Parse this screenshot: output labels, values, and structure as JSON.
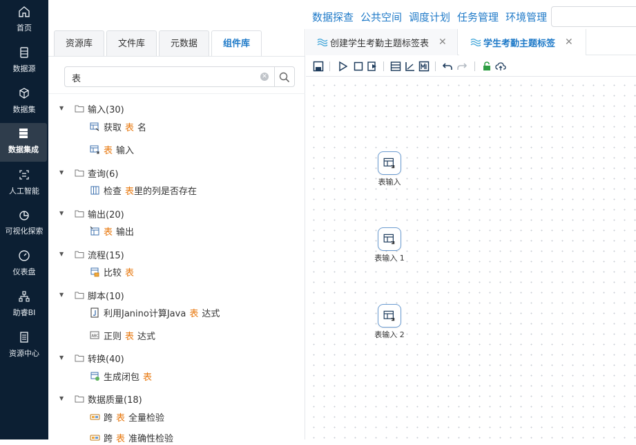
{
  "sidebar": {
    "items": [
      {
        "label": "首页",
        "icon": "home-icon"
      },
      {
        "label": "数据源",
        "icon": "database-icon"
      },
      {
        "label": "数据集",
        "icon": "cube-icon"
      },
      {
        "label": "数据集成",
        "icon": "server-stack-icon",
        "active": true
      },
      {
        "label": "人工智能",
        "icon": "ai-scan-icon"
      },
      {
        "label": "可视化探索",
        "icon": "pie-chart-icon"
      },
      {
        "label": "仪表盘",
        "icon": "gauge-icon"
      },
      {
        "label": "助睿BI",
        "icon": "org-chart-icon"
      },
      {
        "label": "资源中心",
        "icon": "document-icon"
      }
    ]
  },
  "topnav": {
    "links": [
      "数据探查",
      "公共空间",
      "调度计划",
      "任务管理",
      "环境管理"
    ]
  },
  "library": {
    "tabs": [
      "资源库",
      "文件库",
      "元数据",
      "组件库"
    ],
    "active_tab": "组件库",
    "search": {
      "value": "表"
    },
    "tree": [
      {
        "label": "输入(30)",
        "items": [
          {
            "before": "获取",
            "hl": "表",
            "after": "名",
            "icon": "get-table-name-icon"
          },
          {
            "before": "",
            "hl": "表",
            "after": "输入",
            "icon": "table-input-icon"
          }
        ]
      },
      {
        "label": "查询(6)",
        "items": [
          {
            "before": "检查",
            "hl": "表",
            "after": "里的列是否存在",
            "icon": "check-columns-icon"
          }
        ]
      },
      {
        "label": "输出(20)",
        "items": [
          {
            "before": "",
            "hl": "表",
            "after": "输出",
            "icon": "table-output-icon"
          }
        ]
      },
      {
        "label": "流程(15)",
        "items": [
          {
            "before": "比较",
            "hl": "表",
            "after": "",
            "icon": "compare-table-icon"
          }
        ]
      },
      {
        "label": "脚本(10)",
        "items": [
          {
            "before": "利用Janino计算Java",
            "hl": "表",
            "after": "达式",
            "icon": "java-script-icon"
          },
          {
            "before": "正则",
            "hl": "表",
            "after": "达式",
            "icon": "regex-icon"
          }
        ]
      },
      {
        "label": "转换(40)",
        "items": [
          {
            "before": "生成闭包",
            "hl": "表",
            "after": "",
            "icon": "closure-icon"
          }
        ]
      },
      {
        "label": "数据质量(18)",
        "items": [
          {
            "before": "跨",
            "hl": "表",
            "after": "全量检验",
            "icon": "cross-table-check-icon"
          },
          {
            "before": "跨",
            "hl": "表",
            "after": "准确性检验",
            "icon": "cross-table-accuracy-icon"
          }
        ]
      }
    ]
  },
  "editor": {
    "tabs": [
      {
        "label": "创建学生考勤主题标签表",
        "active": false
      },
      {
        "label": "学生考勤主题标签",
        "active": true
      }
    ],
    "close_glyph": "✕",
    "nodes": [
      "表输入",
      "表输入 1",
      "表输入 2"
    ]
  },
  "colors": {
    "sidebar_bg": "#0c1f33",
    "accent": "#1f7ac8",
    "highlight": "#e8780e"
  }
}
